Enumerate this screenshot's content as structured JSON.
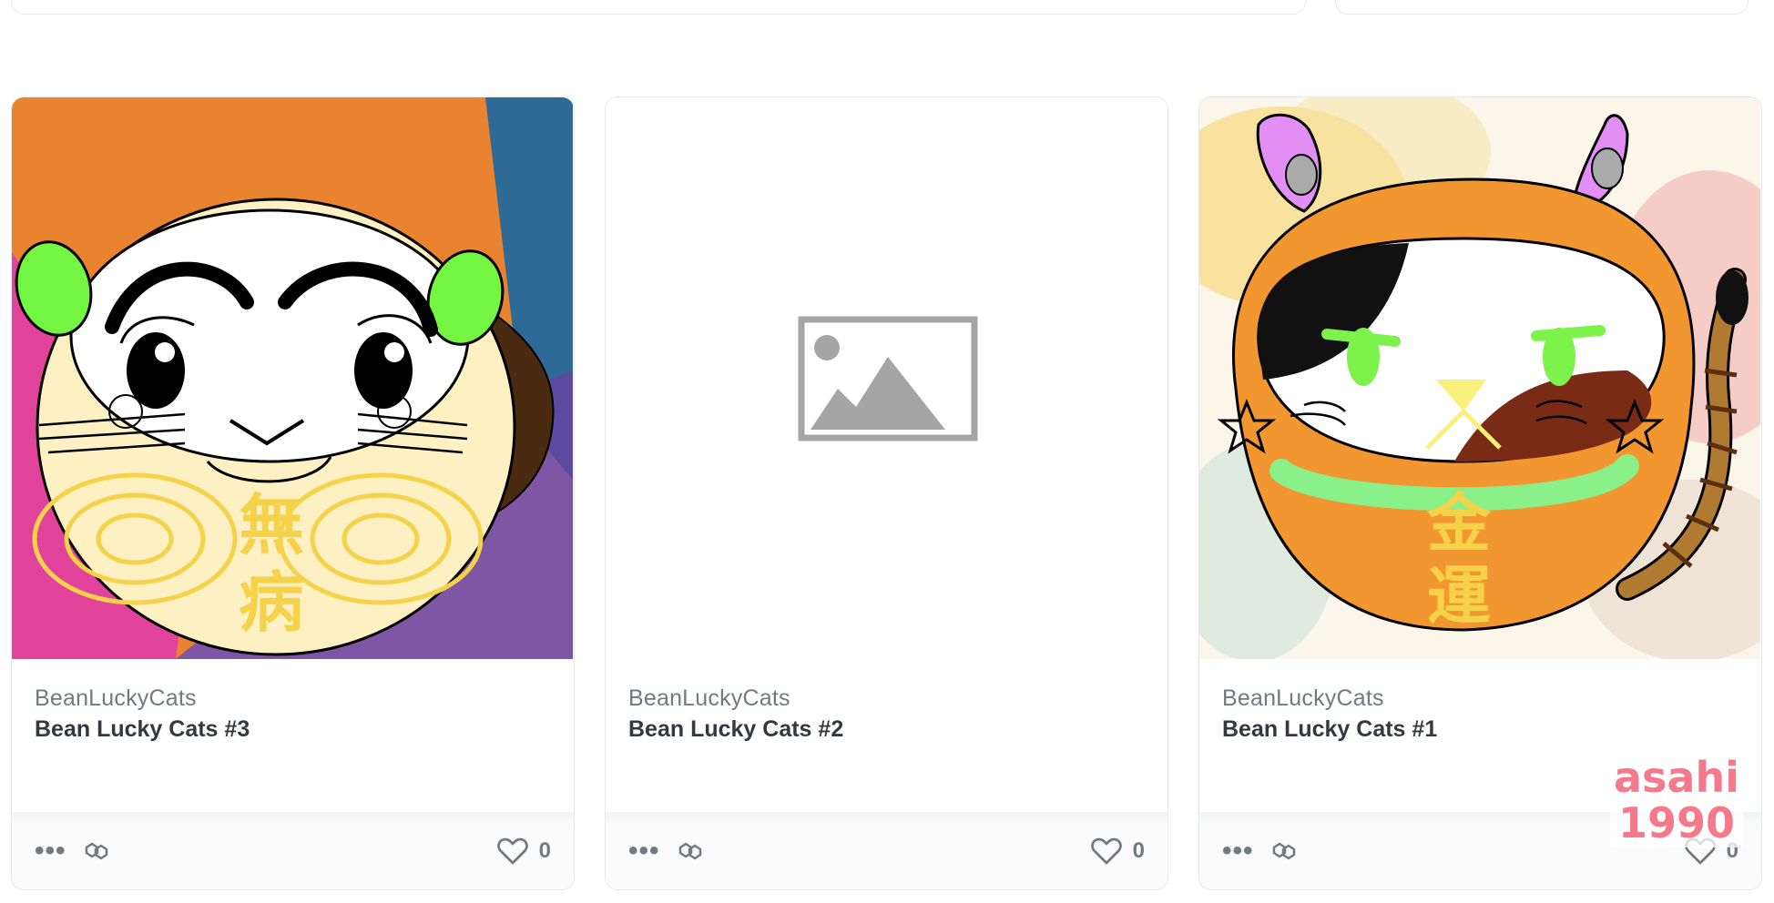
{
  "cards": [
    {
      "collection": "BeanLuckyCats",
      "name": "Bean Lucky Cats #3",
      "likes": "0",
      "image": "bean-lucky-cat-3-illustration",
      "kanji": [
        "無",
        "病"
      ]
    },
    {
      "collection": "BeanLuckyCats",
      "name": "Bean Lucky Cats #2",
      "likes": "0",
      "image": "image-placeholder-icon"
    },
    {
      "collection": "BeanLuckyCats",
      "name": "Bean Lucky Cats #1",
      "likes": "0",
      "image": "bean-lucky-cat-1-illustration",
      "kanji": [
        "金",
        "運"
      ]
    }
  ],
  "footer_icons": [
    "more-options-icon",
    "polygon-chain-icon",
    "heart-icon"
  ],
  "watermark": {
    "line1": "asahi",
    "line2": "1990"
  },
  "colors": {
    "border": "#e5e8eb",
    "collection_text": "#707a83",
    "name_text": "#353840",
    "watermark": "#f47a8b"
  }
}
